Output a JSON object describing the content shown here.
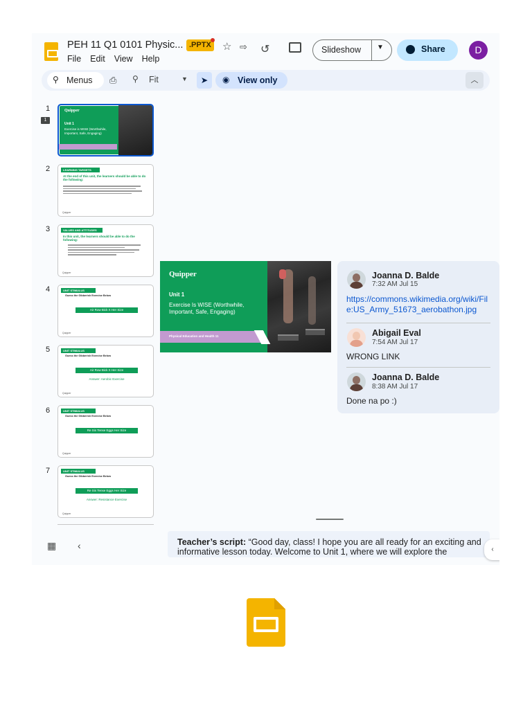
{
  "header": {
    "doc_title": "PEH 11 Q1 0101 Physic...",
    "file_badge": ".PPTX",
    "menus": [
      "File",
      "Edit",
      "View",
      "Help"
    ],
    "slideshow_label": "Slideshow",
    "share_label": "Share",
    "avatar_initial": "D"
  },
  "toolbar": {
    "menus_label": "Menus",
    "zoom_label": "Fit",
    "view_only_label": "View only"
  },
  "filmstrip": {
    "slides": [
      {
        "num": "1",
        "header": "Quipper",
        "unit": "Unit 1",
        "title": "Exercise is WISE (Worthwhile, Important, Safe, Engaging)"
      },
      {
        "num": "2",
        "header": "LEARNING TARGETS",
        "subtitle": "At the end of this unit, the learners should be able to do the following:"
      },
      {
        "num": "3",
        "header": "VALUES AND ATTITUDES",
        "subtitle": "In this unit, the learners should be able to do the following:"
      },
      {
        "num": "4",
        "header": "UNIT STIMULUS",
        "subtitle": "Guess the Gibberish Exercise Below",
        "bar": "Air Row Bick X Her Size"
      },
      {
        "num": "5",
        "header": "UNIT STIMULUS",
        "subtitle": "Guess the Gibberish Exercise Below",
        "bar": "Air Row Bick X Her Size",
        "answer": "Answer: Aerobic Exercise"
      },
      {
        "num": "6",
        "header": "UNIT STIMULUS",
        "subtitle": "Guess the Gibberish Exercise Below",
        "bar": "Re Sis Tense Eggs Her Size"
      },
      {
        "num": "7",
        "header": "UNIT STIMULUS",
        "subtitle": "Guess the Gibberish Exercise Below",
        "bar": "Re Sis Tense Eggs Her Size",
        "answer": "Answer: Resistance Exercise"
      }
    ],
    "comment_count": "1"
  },
  "slide": {
    "brand": "Quipper",
    "unit": "Unit 1",
    "title": "Exercise Is WISE (Worthwhile, Important, Safe, Engaging)",
    "band_label": "Physical Education and Health 11"
  },
  "comments": [
    {
      "name": "Joanna D. Balde",
      "time": "7:32 AM Jul 15",
      "text": "https://commons.wikimedia.org/wiki/File:US_Army_51673_aerobathon.jpg",
      "is_link": true
    },
    {
      "name": "Abigail Eval",
      "time": "7:54 AM Jul 17",
      "text": "WRONG LINK",
      "is_link": false
    },
    {
      "name": "Joanna D. Balde",
      "time": "8:38 AM Jul 17",
      "text": "Done na po :)",
      "is_link": false
    }
  ],
  "notes": {
    "label": "Teacher’s script:",
    "text": " “Good day, class! I hope you are all ready for an exciting and informative lesson today. Welcome to Unit 1, where we will explore the"
  },
  "colors": {
    "slides_yellow": "#f4b400",
    "green": "#0f9d58",
    "purple_band": "#c29ad0",
    "share_bg": "#c2e7ff",
    "selected_border": "#0b57d0"
  },
  "icons": [
    "star-icon",
    "history-icon",
    "comment-icon",
    "print-icon",
    "zoom-icon",
    "pointer-icon",
    "eye-icon",
    "grid-icon"
  ]
}
